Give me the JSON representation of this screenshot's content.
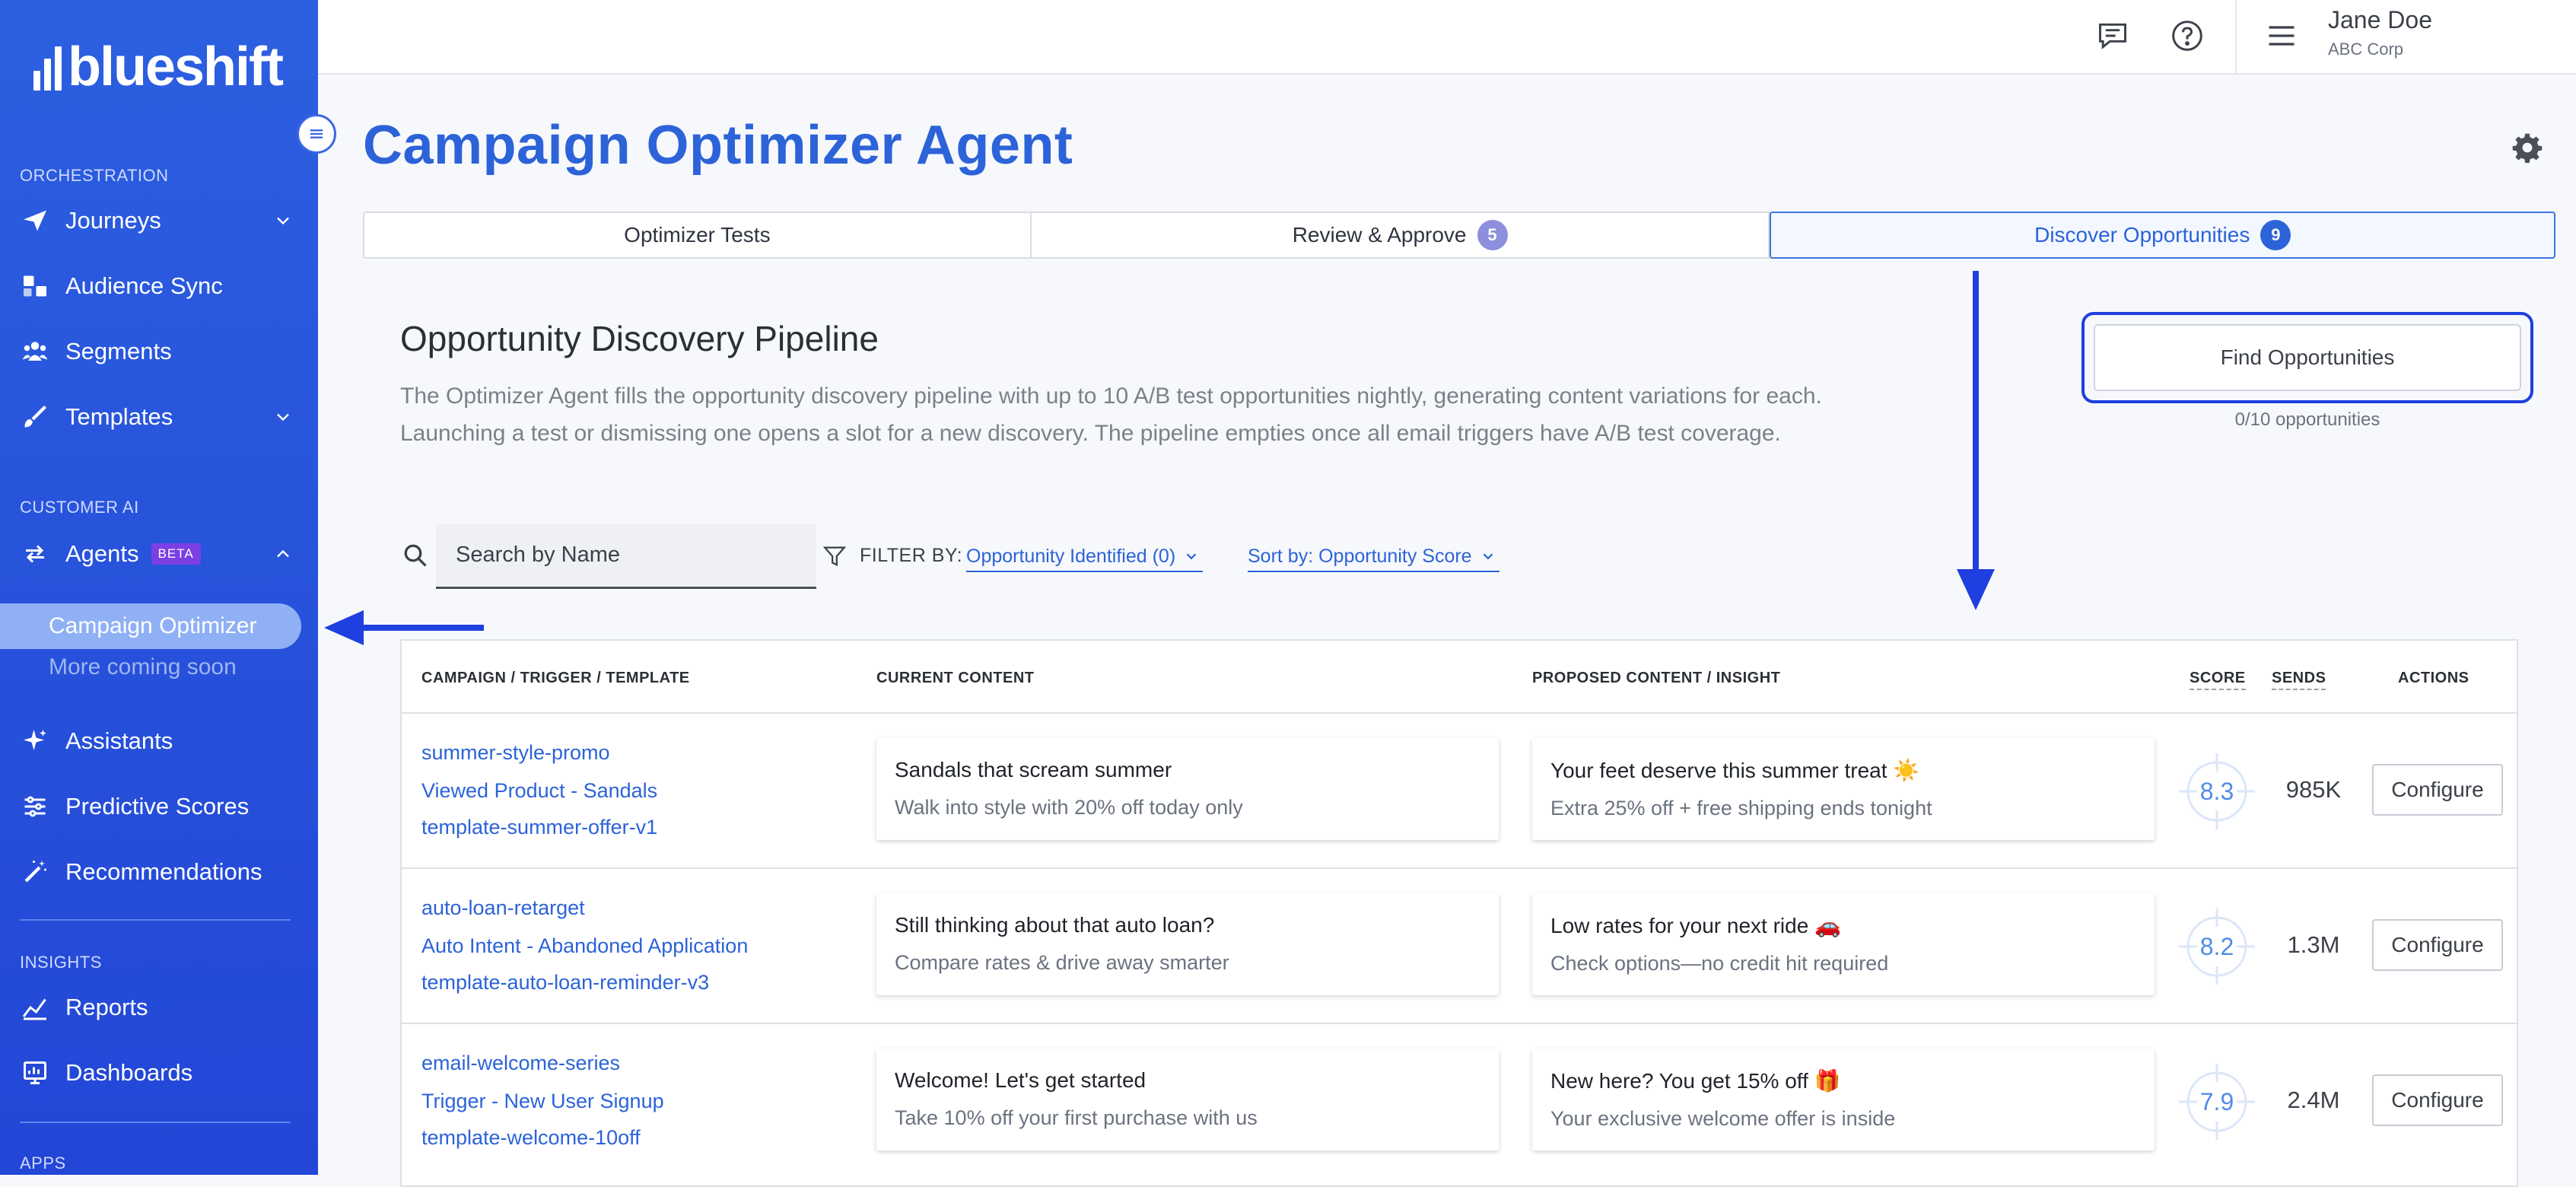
{
  "brand": {
    "name": "blueshift"
  },
  "sidebar": {
    "sections": {
      "orchestration": "ORCHESTRATION",
      "customer_ai": "CUSTOMER AI",
      "insights": "INSIGHTS",
      "apps": "APPS"
    },
    "items": [
      {
        "label": "Journeys",
        "icon": "paper-plane-icon"
      },
      {
        "label": "Audience Sync",
        "icon": "sync-icon"
      },
      {
        "label": "Segments",
        "icon": "users-icon"
      },
      {
        "label": "Templates",
        "icon": "brush-icon"
      },
      {
        "label": "Agents",
        "icon": "arrows-icon",
        "badge": "BETA"
      },
      {
        "label": "Assistants",
        "icon": "sparkle-icon"
      },
      {
        "label": "Predictive Scores",
        "icon": "sliders-icon"
      },
      {
        "label": "Recommendations",
        "icon": "magic-wand-icon"
      },
      {
        "label": "Reports",
        "icon": "chart-line-icon"
      },
      {
        "label": "Dashboards",
        "icon": "dashboard-icon"
      }
    ],
    "sub_active": "Campaign Optimizer",
    "sub_coming": "More coming soon"
  },
  "topbar": {
    "user_name": "Jane Doe",
    "user_org": "ABC Corp"
  },
  "page": {
    "title": "Campaign Optimizer Agent",
    "tabs": [
      {
        "label": "Optimizer Tests",
        "count": null
      },
      {
        "label": "Review & Approve",
        "count": "5"
      },
      {
        "label": "Discover Opportunities",
        "count": "9"
      }
    ],
    "section_title": "Opportunity Discovery Pipeline",
    "section_desc_1": "The Optimizer Agent fills the opportunity discovery pipeline with up to 10 A/B test opportunities nightly, generating content variations for each.",
    "section_desc_2": "Launching a test or dismissing one opens a slot for a new discovery. The pipeline empties once all email triggers have A/B test coverage.",
    "find_button": "Find Opportunities",
    "find_count": "0/10 opportunities"
  },
  "filters": {
    "search_placeholder": "Search by Name",
    "filter_by_label": "FILTER BY:",
    "filter_value": "Opportunity Identified (0)",
    "sort_value": "Sort by: Opportunity Score"
  },
  "table": {
    "headers": {
      "campaign": "CAMPAIGN / TRIGGER / TEMPLATE",
      "current": "CURRENT CONTENT",
      "proposed": "PROPOSED CONTENT / INSIGHT",
      "score": "SCORE",
      "sends": "SENDS",
      "actions": "ACTIONS"
    },
    "rows": [
      {
        "campaign": "summer-style-promo",
        "trigger": "Viewed Product - Sandals",
        "template": "template-summer-offer-v1",
        "current_title": "Sandals that scream summer",
        "current_sub": "Walk into style with 20% off today only",
        "proposed_title": "Your feet deserve this summer treat ☀️",
        "proposed_sub": "Extra 25% off + free shipping ends tonight",
        "score": "8.3",
        "sends": "985K",
        "action": "Configure"
      },
      {
        "campaign": "auto-loan-retarget",
        "trigger": "Auto Intent - Abandoned Application",
        "template": "template-auto-loan-reminder-v3",
        "current_title": "Still thinking about that auto loan?",
        "current_sub": "Compare rates & drive away smarter",
        "proposed_title": "Low rates for your next ride 🚗",
        "proposed_sub": "Check options—no credit hit required",
        "score": "8.2",
        "sends": "1.3M",
        "action": "Configure"
      },
      {
        "campaign": "email-welcome-series",
        "trigger": "Trigger - New User Signup",
        "template": "template-welcome-10off",
        "current_title": "Welcome! Let's get started",
        "current_sub": "Take 10% off your first purchase with us",
        "proposed_title": "New here? You get 15% off 🎁",
        "proposed_sub": "Your exclusive welcome offer is inside",
        "score": "7.9",
        "sends": "2.4M",
        "action": "Configure"
      }
    ]
  },
  "colors": {
    "sidebar_bg": "#2c5fe0",
    "accent": "#2c63d8",
    "highlight_border": "#1f3fe0",
    "annotation_arrow": "#1f3fe0",
    "tab_count": "#8c8fdc"
  }
}
